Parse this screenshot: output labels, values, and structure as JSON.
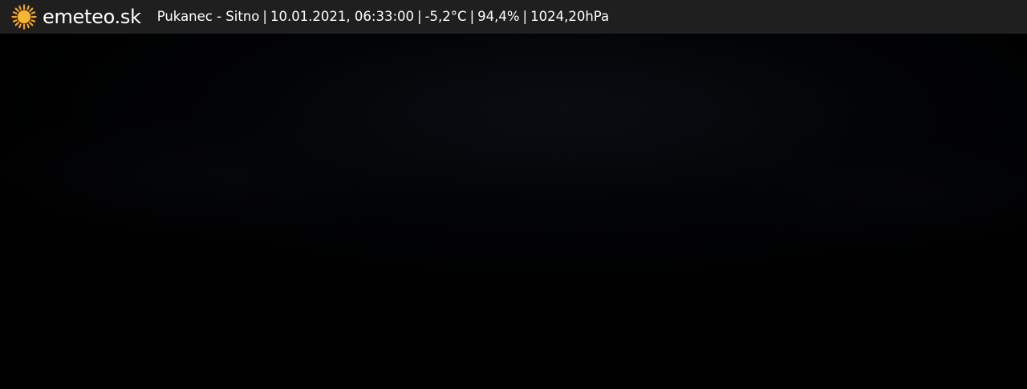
{
  "header": {
    "brand": "emeteo.sk",
    "logo_icon": "sun-icon",
    "location": "Pukanec - Sitno",
    "datetime": "10.01.2021, 06:33:00",
    "temperature": "-5,2°C",
    "humidity": "94,4%",
    "pressure": "1024,20hPa",
    "separator": "|"
  },
  "colors": {
    "bar_background": "#1f1f1f",
    "sun": "#f5a623",
    "text": "#ffffff"
  }
}
